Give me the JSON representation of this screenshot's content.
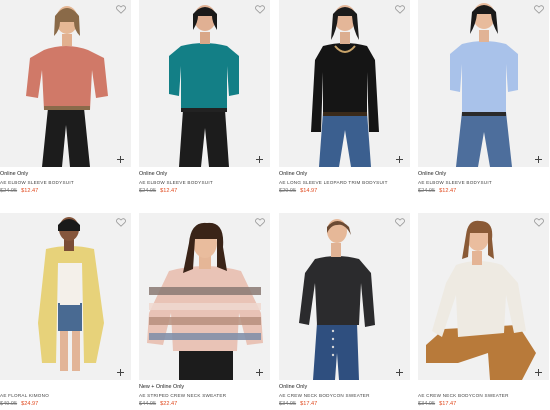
{
  "products": [
    {
      "badge": "Online Only",
      "name": "AE Elbow Sleeve Bodysuit",
      "old_price": "$24.95",
      "sale_price": "$12.47",
      "top_color": "#d07968",
      "bottom_color": "#1c1c1c"
    },
    {
      "badge": "Online Only",
      "name": "AE Elbow Sleeve Bodysuit",
      "old_price": "$24.95",
      "sale_price": "$12.47",
      "top_color": "#137f86",
      "bottom_color": "#1c1c1c"
    },
    {
      "badge": "Online Only",
      "name": "AE Long Sleeve Leopard Trim Bodysuit",
      "old_price": "$29.95",
      "sale_price": "$14.97",
      "top_color": "#151515",
      "bottom_color": "#3b5f8f"
    },
    {
      "badge": "Online Only",
      "name": "AE Elbow Sleeve Bodysuit",
      "old_price": "$24.95",
      "sale_price": "$12.47",
      "top_color": "#a9c2ea",
      "bottom_color": "#4d6e9c"
    },
    {
      "badge": "",
      "name": "AE Floral Kimono",
      "old_price": "$49.95",
      "sale_price": "$24.97",
      "top_color": "#e7d27a",
      "bottom_color": "#496a92"
    },
    {
      "badge": "New + Online Only",
      "name": "AE Striped Crew Neck Sweater",
      "old_price": "$44.95",
      "sale_price": "$22.47",
      "top_color": "#e9c3b6",
      "bottom_color": "#1c1c1c"
    },
    {
      "badge": "Online Only",
      "name": "AE Crew Neck Bodycon Sweater",
      "old_price": "$34.95",
      "sale_price": "$17.47",
      "top_color": "#2b2b2d",
      "bottom_color": "#2f4f7f"
    },
    {
      "badge": "",
      "name": "AE Crew Neck Bodycon Sweater",
      "old_price": "$34.95",
      "sale_price": "$17.47",
      "top_color": "#eeeae2",
      "bottom_color": "#b87a3a"
    }
  ],
  "icons": {
    "favorite": "heart-icon",
    "quick_add": "plus-icon"
  },
  "colors": {
    "sale": "#e04a1f",
    "image_bg": "#f1f1f1"
  }
}
